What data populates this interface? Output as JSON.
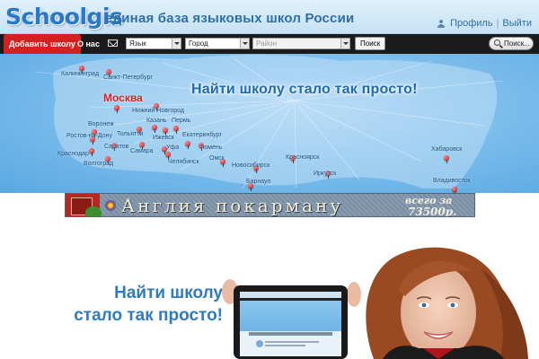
{
  "header": {
    "logo": "Schoolgis",
    "tagline": "единая база языковых школ России",
    "profile_label": "Профиль",
    "logout_label": "Выйти"
  },
  "nav": {
    "add_school_label": "Добавить школу",
    "about_label": "О нас",
    "language_select": "Язык",
    "city_select": "Город",
    "district_select": "Район",
    "find_label": "Поиск",
    "search_label": "Поиск..."
  },
  "map": {
    "headline": "Найти школу стало так просто!",
    "cities": [
      {
        "name": "Калининград"
      },
      {
        "name": "Санкт-Петербург"
      },
      {
        "name": "Москва",
        "major": true
      },
      {
        "name": "Нижний Новгород"
      },
      {
        "name": "Казань"
      },
      {
        "name": "Пермь"
      },
      {
        "name": "Воронеж"
      },
      {
        "name": "Ростов-на-Дону"
      },
      {
        "name": "Тольятти"
      },
      {
        "name": "Ижевск"
      },
      {
        "name": "Екатеринбург"
      },
      {
        "name": "Саратов"
      },
      {
        "name": "Уфа"
      },
      {
        "name": "Тюмень"
      },
      {
        "name": "Самара"
      },
      {
        "name": "Краснодар"
      },
      {
        "name": "Волгоград"
      },
      {
        "name": "Челябинск"
      },
      {
        "name": "Омск"
      },
      {
        "name": "Новосибирск"
      },
      {
        "name": "Красноярск"
      },
      {
        "name": "Хабаровск"
      },
      {
        "name": "Иркутск"
      },
      {
        "name": "Барнаул"
      },
      {
        "name": "Владивосток"
      }
    ]
  },
  "banner": {
    "text": "Англия покарману",
    "price_line1": "всего за",
    "price_line2": "73500р."
  },
  "promo": {
    "line1": "Найти школу",
    "line2": "стало так просто!"
  },
  "colors": {
    "accent_red": "#d4201f",
    "brand_blue": "#2a78c8",
    "nav_bg": "#1b1b1b"
  }
}
